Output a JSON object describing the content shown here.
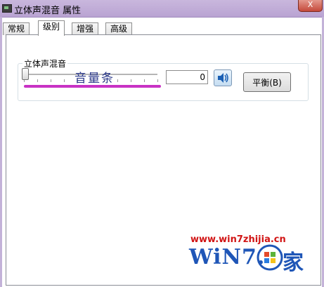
{
  "window": {
    "title": "立体声混音 属性",
    "close_label": "X"
  },
  "tabs": [
    {
      "label": "常规",
      "active": false
    },
    {
      "label": "级别",
      "active": true
    },
    {
      "label": "增强",
      "active": false
    },
    {
      "label": "高级",
      "active": false
    }
  ],
  "levels": {
    "group_title": "立体声混音",
    "annotation": "音量条",
    "volume_value": "0",
    "volume_level": 0,
    "speaker_icon": "speaker-icon",
    "balance_label": "平衡(B)"
  },
  "watermark": {
    "url": "www.win7zhijia.cn",
    "logo_text": "WiN7.",
    "logo_char": "家"
  },
  "colors": {
    "annotation_line": "#c832c4",
    "title_bar": "#c4b0db",
    "watermark_red": "#d11414",
    "watermark_blue": "#1f56b7"
  }
}
